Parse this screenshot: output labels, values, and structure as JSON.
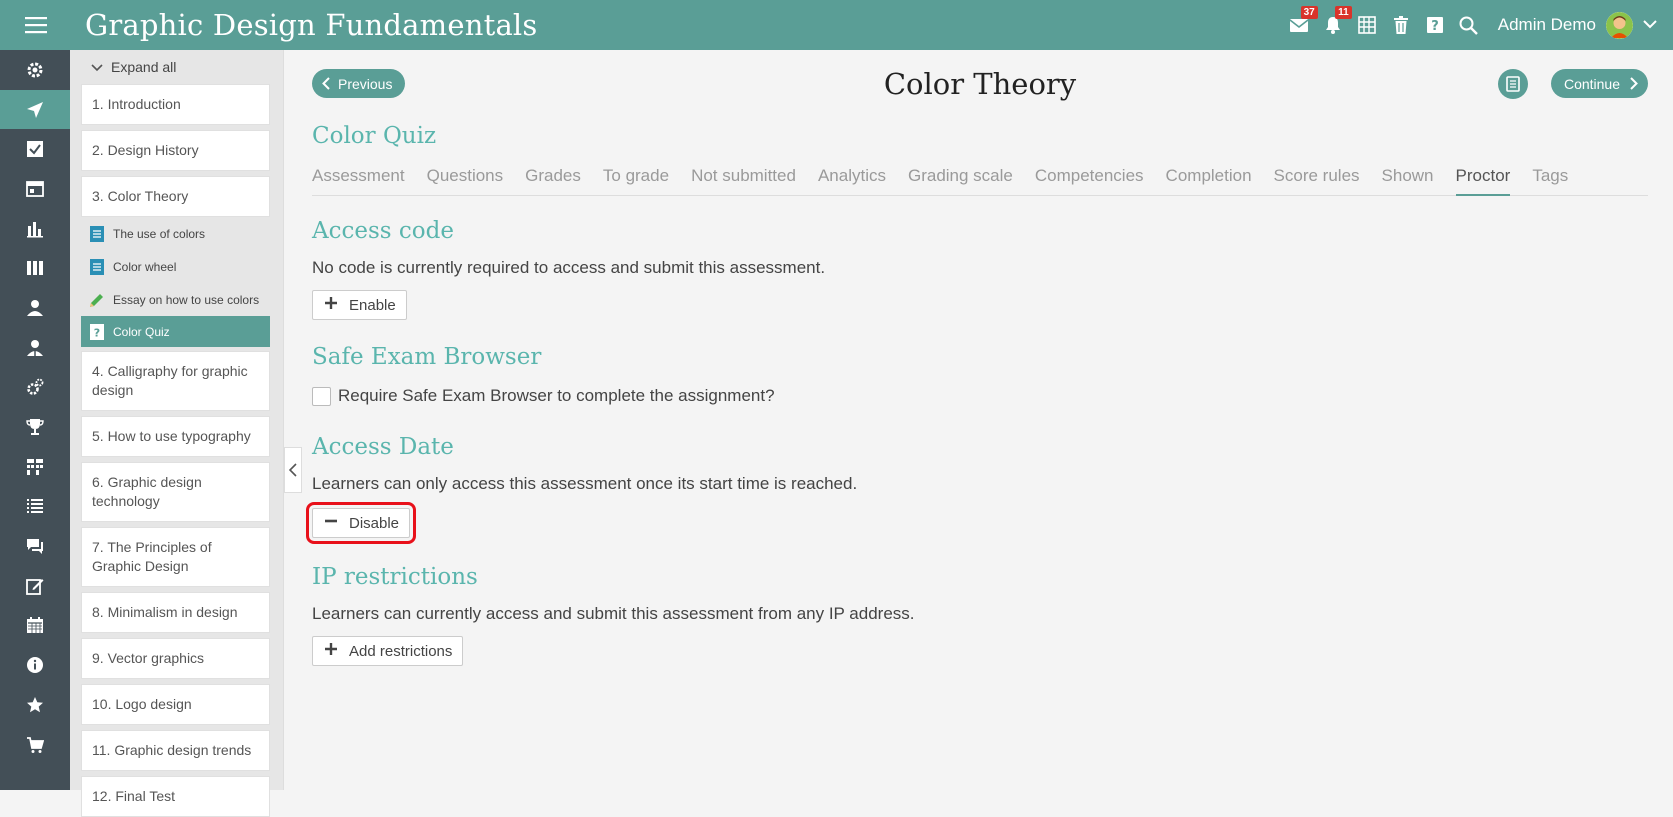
{
  "header": {
    "title": "Graphic Design Fundamentals",
    "messages_count": "37",
    "notifications_count": "11",
    "user_name": "Admin Demo"
  },
  "outline": {
    "expand_all": "Expand all",
    "units_before": [
      "1. Introduction",
      "2. Design History",
      "3. Color Theory"
    ],
    "subitems": [
      {
        "label": "The use of colors",
        "icon": "document-icon"
      },
      {
        "label": "Color wheel",
        "icon": "document-icon"
      },
      {
        "label": "Essay on how to use colors",
        "icon": "pencil-icon"
      },
      {
        "label": "Color Quiz",
        "icon": "quiz-icon"
      }
    ],
    "units_after": [
      "4. Calligraphy for graphic design",
      "5. How to use typography",
      "6. Graphic design technology",
      "7. The Principles of Graphic Design",
      "8. Minimalism in design",
      "9. Vector graphics",
      "10. Logo design",
      "11. Graphic design trends",
      "12. Final Test"
    ]
  },
  "nav": {
    "previous": "Previous",
    "lesson_title": "Color Theory",
    "continue": "Continue"
  },
  "quiz": {
    "title": "Color Quiz",
    "tabs": [
      "Assessment",
      "Questions",
      "Grades",
      "To grade",
      "Not submitted",
      "Analytics",
      "Grading scale",
      "Competencies",
      "Completion",
      "Score rules",
      "Shown",
      "Proctor",
      "Tags"
    ],
    "active_tab": "Proctor"
  },
  "sections": {
    "access_code": {
      "heading": "Access code",
      "text": "No code is currently required to access and submit this assessment.",
      "button": "Enable"
    },
    "seb": {
      "heading": "Safe Exam Browser",
      "checkbox_label": "Require Safe Exam Browser to complete the assignment?"
    },
    "access_date": {
      "heading": "Access Date",
      "text": "Learners can only access this assessment once its start time is reached.",
      "button": "Disable"
    },
    "ip": {
      "heading": "IP restrictions",
      "text": "Learners can currently access and submit this assessment from any IP address.",
      "button": "Add restrictions"
    }
  },
  "colors": {
    "accent": "#5a9e96",
    "heading": "#5ab5ad",
    "rail": "#434f57",
    "badge": "#d9342b",
    "highlight": "#e8101a"
  }
}
